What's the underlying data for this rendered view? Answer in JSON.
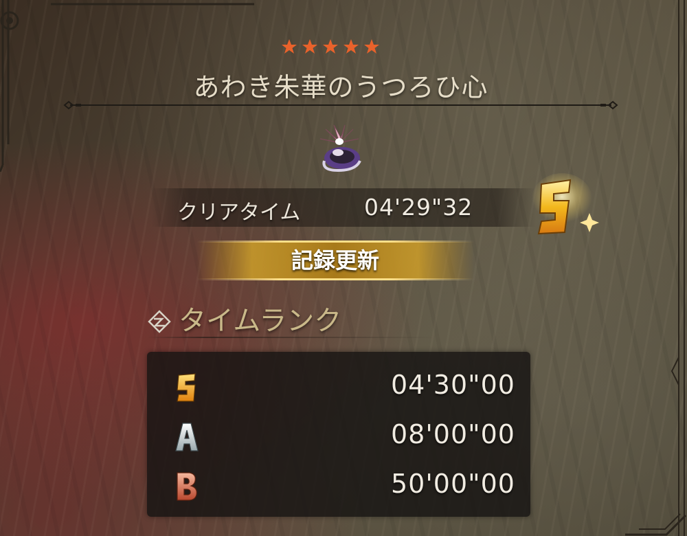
{
  "quest": {
    "stars": 5,
    "title": "あわき朱華のうつろひ心"
  },
  "monster": {
    "icon": "monster-icon"
  },
  "result": {
    "clear_label": "クリアタイム",
    "clear_time": "04'29\"32",
    "achieved_rank": "S",
    "record_label": "記録更新"
  },
  "time_rank": {
    "heading": "タイムランク",
    "rows": [
      {
        "rank": "S",
        "time": "04'30\"00",
        "color": "#f2b21a"
      },
      {
        "rank": "A",
        "time": "08'00\"00",
        "color": "#cfd6d8"
      },
      {
        "rank": "B",
        "time": "50'00\"00",
        "color": "#e0735a"
      }
    ]
  },
  "colors": {
    "star": "#e9622b",
    "title": "#e6ddc8",
    "heading": "#c9b889",
    "gold": "#e4b424"
  }
}
